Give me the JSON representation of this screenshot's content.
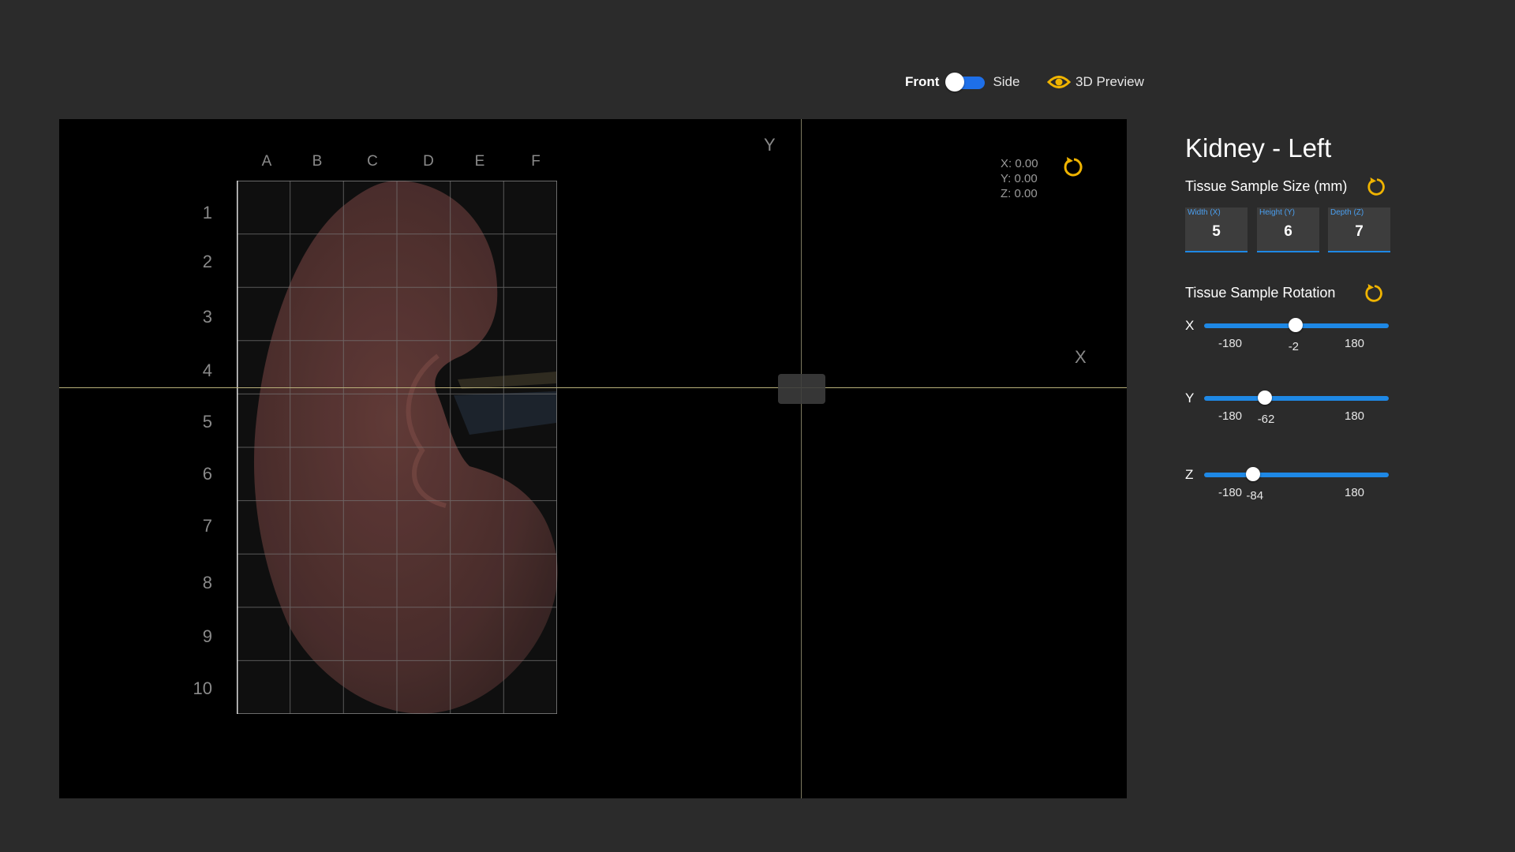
{
  "view_toggle": {
    "front_label": "Front",
    "side_label": "Side",
    "selected": "Front"
  },
  "preview": {
    "label": "3D Preview",
    "icon": "eye-icon"
  },
  "viewport": {
    "columns": [
      "A",
      "B",
      "C",
      "D",
      "E",
      "F"
    ],
    "rows": [
      "1",
      "2",
      "3",
      "4",
      "5",
      "6",
      "7",
      "8",
      "9",
      "10"
    ],
    "axis_y_label": "Y",
    "axis_x_label": "X",
    "coords": {
      "x": "X: 0.00",
      "y": "Y: 0.00",
      "z": "Z: 0.00"
    },
    "reset_icon": "reset-icon"
  },
  "panel": {
    "title": "Kidney - Left",
    "size_section": "Tissue Sample Size (mm)",
    "size_fields": [
      {
        "label": "Width (X)",
        "value": "5"
      },
      {
        "label": "Height (Y)",
        "value": "6"
      },
      {
        "label": "Depth (Z)",
        "value": "7"
      }
    ],
    "rotation_section": "Tissue Sample Rotation",
    "rotation": [
      {
        "axis": "X",
        "min": "-180",
        "max": "180",
        "value": -2,
        "display": "-2"
      },
      {
        "axis": "Y",
        "min": "-180",
        "max": "180",
        "value": -62,
        "display": "-62"
      },
      {
        "axis": "Z",
        "min": "-180",
        "max": "180",
        "value": -84,
        "display": "-84"
      }
    ]
  },
  "colors": {
    "accent": "#1e88e5",
    "toggle": "#1e6fe8",
    "icon": "#f0b400",
    "background": "#2b2b2b"
  }
}
